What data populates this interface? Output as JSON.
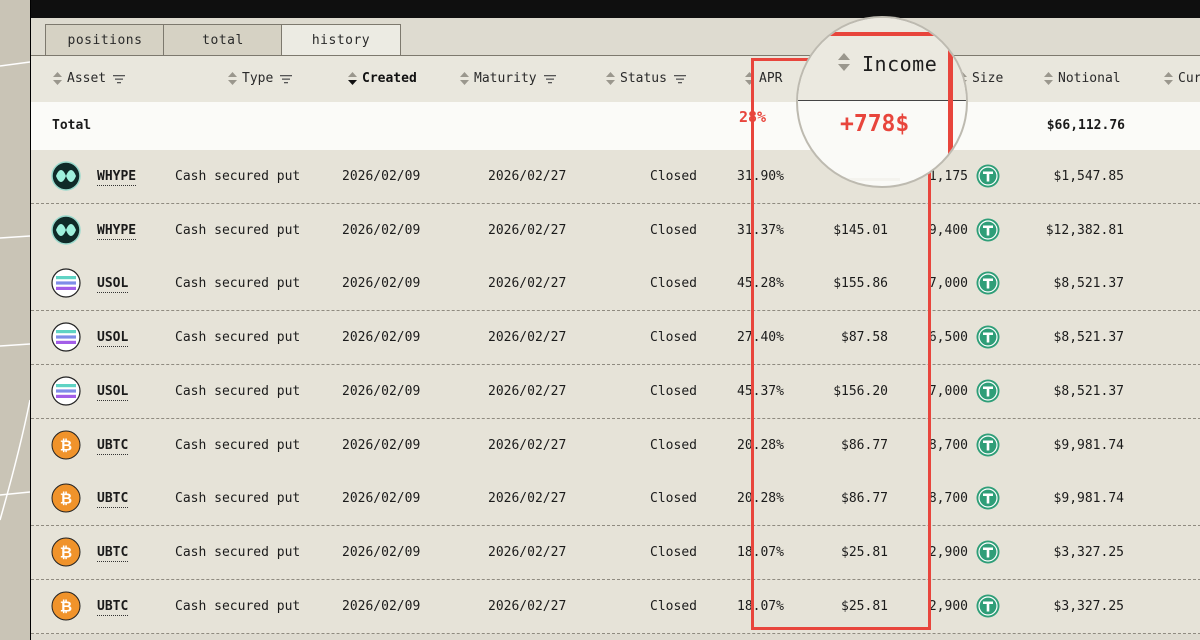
{
  "tabs": [
    {
      "label": "positions",
      "active": false
    },
    {
      "label": "total",
      "active": false
    },
    {
      "label": "history",
      "active": true
    }
  ],
  "columns": {
    "asset": "Asset",
    "type": "Type",
    "created": "Created",
    "maturity": "Maturity",
    "status": "Status",
    "apr": "APR",
    "size": "Size",
    "notional": "Notional",
    "currency": "Cur"
  },
  "total": {
    "label": "Total",
    "apr": "28%",
    "income": "+778$",
    "notional": "$66,112.76"
  },
  "zoom": {
    "title": "Income",
    "value": "+778$"
  },
  "rows": [
    {
      "asset": "WHYPE",
      "icon": "whype-icon",
      "type": "Cash secured put",
      "created": "2026/02/09",
      "maturity": "2026/02/27",
      "status": "Closed",
      "apr": "31.90%",
      "income": "",
      "size": "1,175",
      "notional": "$1,547.85"
    },
    {
      "asset": "WHYPE",
      "icon": "whype-icon",
      "type": "Cash secured put",
      "created": "2026/02/09",
      "maturity": "2026/02/27",
      "status": "Closed",
      "apr": "31.37%",
      "income": "$145.01",
      "size": "9,400",
      "notional": "$12,382.81"
    },
    {
      "asset": "USOL",
      "icon": "usol-icon",
      "type": "Cash secured put",
      "created": "2026/02/09",
      "maturity": "2026/02/27",
      "status": "Closed",
      "apr": "45.28%",
      "income": "$155.86",
      "size": "7,000",
      "notional": "$8,521.37"
    },
    {
      "asset": "USOL",
      "icon": "usol-icon",
      "type": "Cash secured put",
      "created": "2026/02/09",
      "maturity": "2026/02/27",
      "status": "Closed",
      "apr": "27.40%",
      "income": "$87.58",
      "size": "6,500",
      "notional": "$8,521.37"
    },
    {
      "asset": "USOL",
      "icon": "usol-icon",
      "type": "Cash secured put",
      "created": "2026/02/09",
      "maturity": "2026/02/27",
      "status": "Closed",
      "apr": "45.37%",
      "income": "$156.20",
      "size": "7,000",
      "notional": "$8,521.37"
    },
    {
      "asset": "UBTC",
      "icon": "ubtc-icon",
      "type": "Cash secured put",
      "created": "2026/02/09",
      "maturity": "2026/02/27",
      "status": "Closed",
      "apr": "20.28%",
      "income": "$86.77",
      "size": "8,700",
      "notional": "$9,981.74"
    },
    {
      "asset": "UBTC",
      "icon": "ubtc-icon",
      "type": "Cash secured put",
      "created": "2026/02/09",
      "maturity": "2026/02/27",
      "status": "Closed",
      "apr": "20.28%",
      "income": "$86.77",
      "size": "8,700",
      "notional": "$9,981.74"
    },
    {
      "asset": "UBTC",
      "icon": "ubtc-icon",
      "type": "Cash secured put",
      "created": "2026/02/09",
      "maturity": "2026/02/27",
      "status": "Closed",
      "apr": "18.07%",
      "income": "$25.81",
      "size": "2,900",
      "notional": "$3,327.25"
    },
    {
      "asset": "UBTC",
      "icon": "ubtc-icon",
      "type": "Cash secured put",
      "created": "2026/02/09",
      "maturity": "2026/02/27",
      "status": "Closed",
      "apr": "18.07%",
      "income": "$25.81",
      "size": "2,900",
      "notional": "$3,327.25"
    }
  ],
  "colors": {
    "highlight": "#e8453c",
    "tether": "#2f9e78",
    "btc": "#f0932b"
  }
}
